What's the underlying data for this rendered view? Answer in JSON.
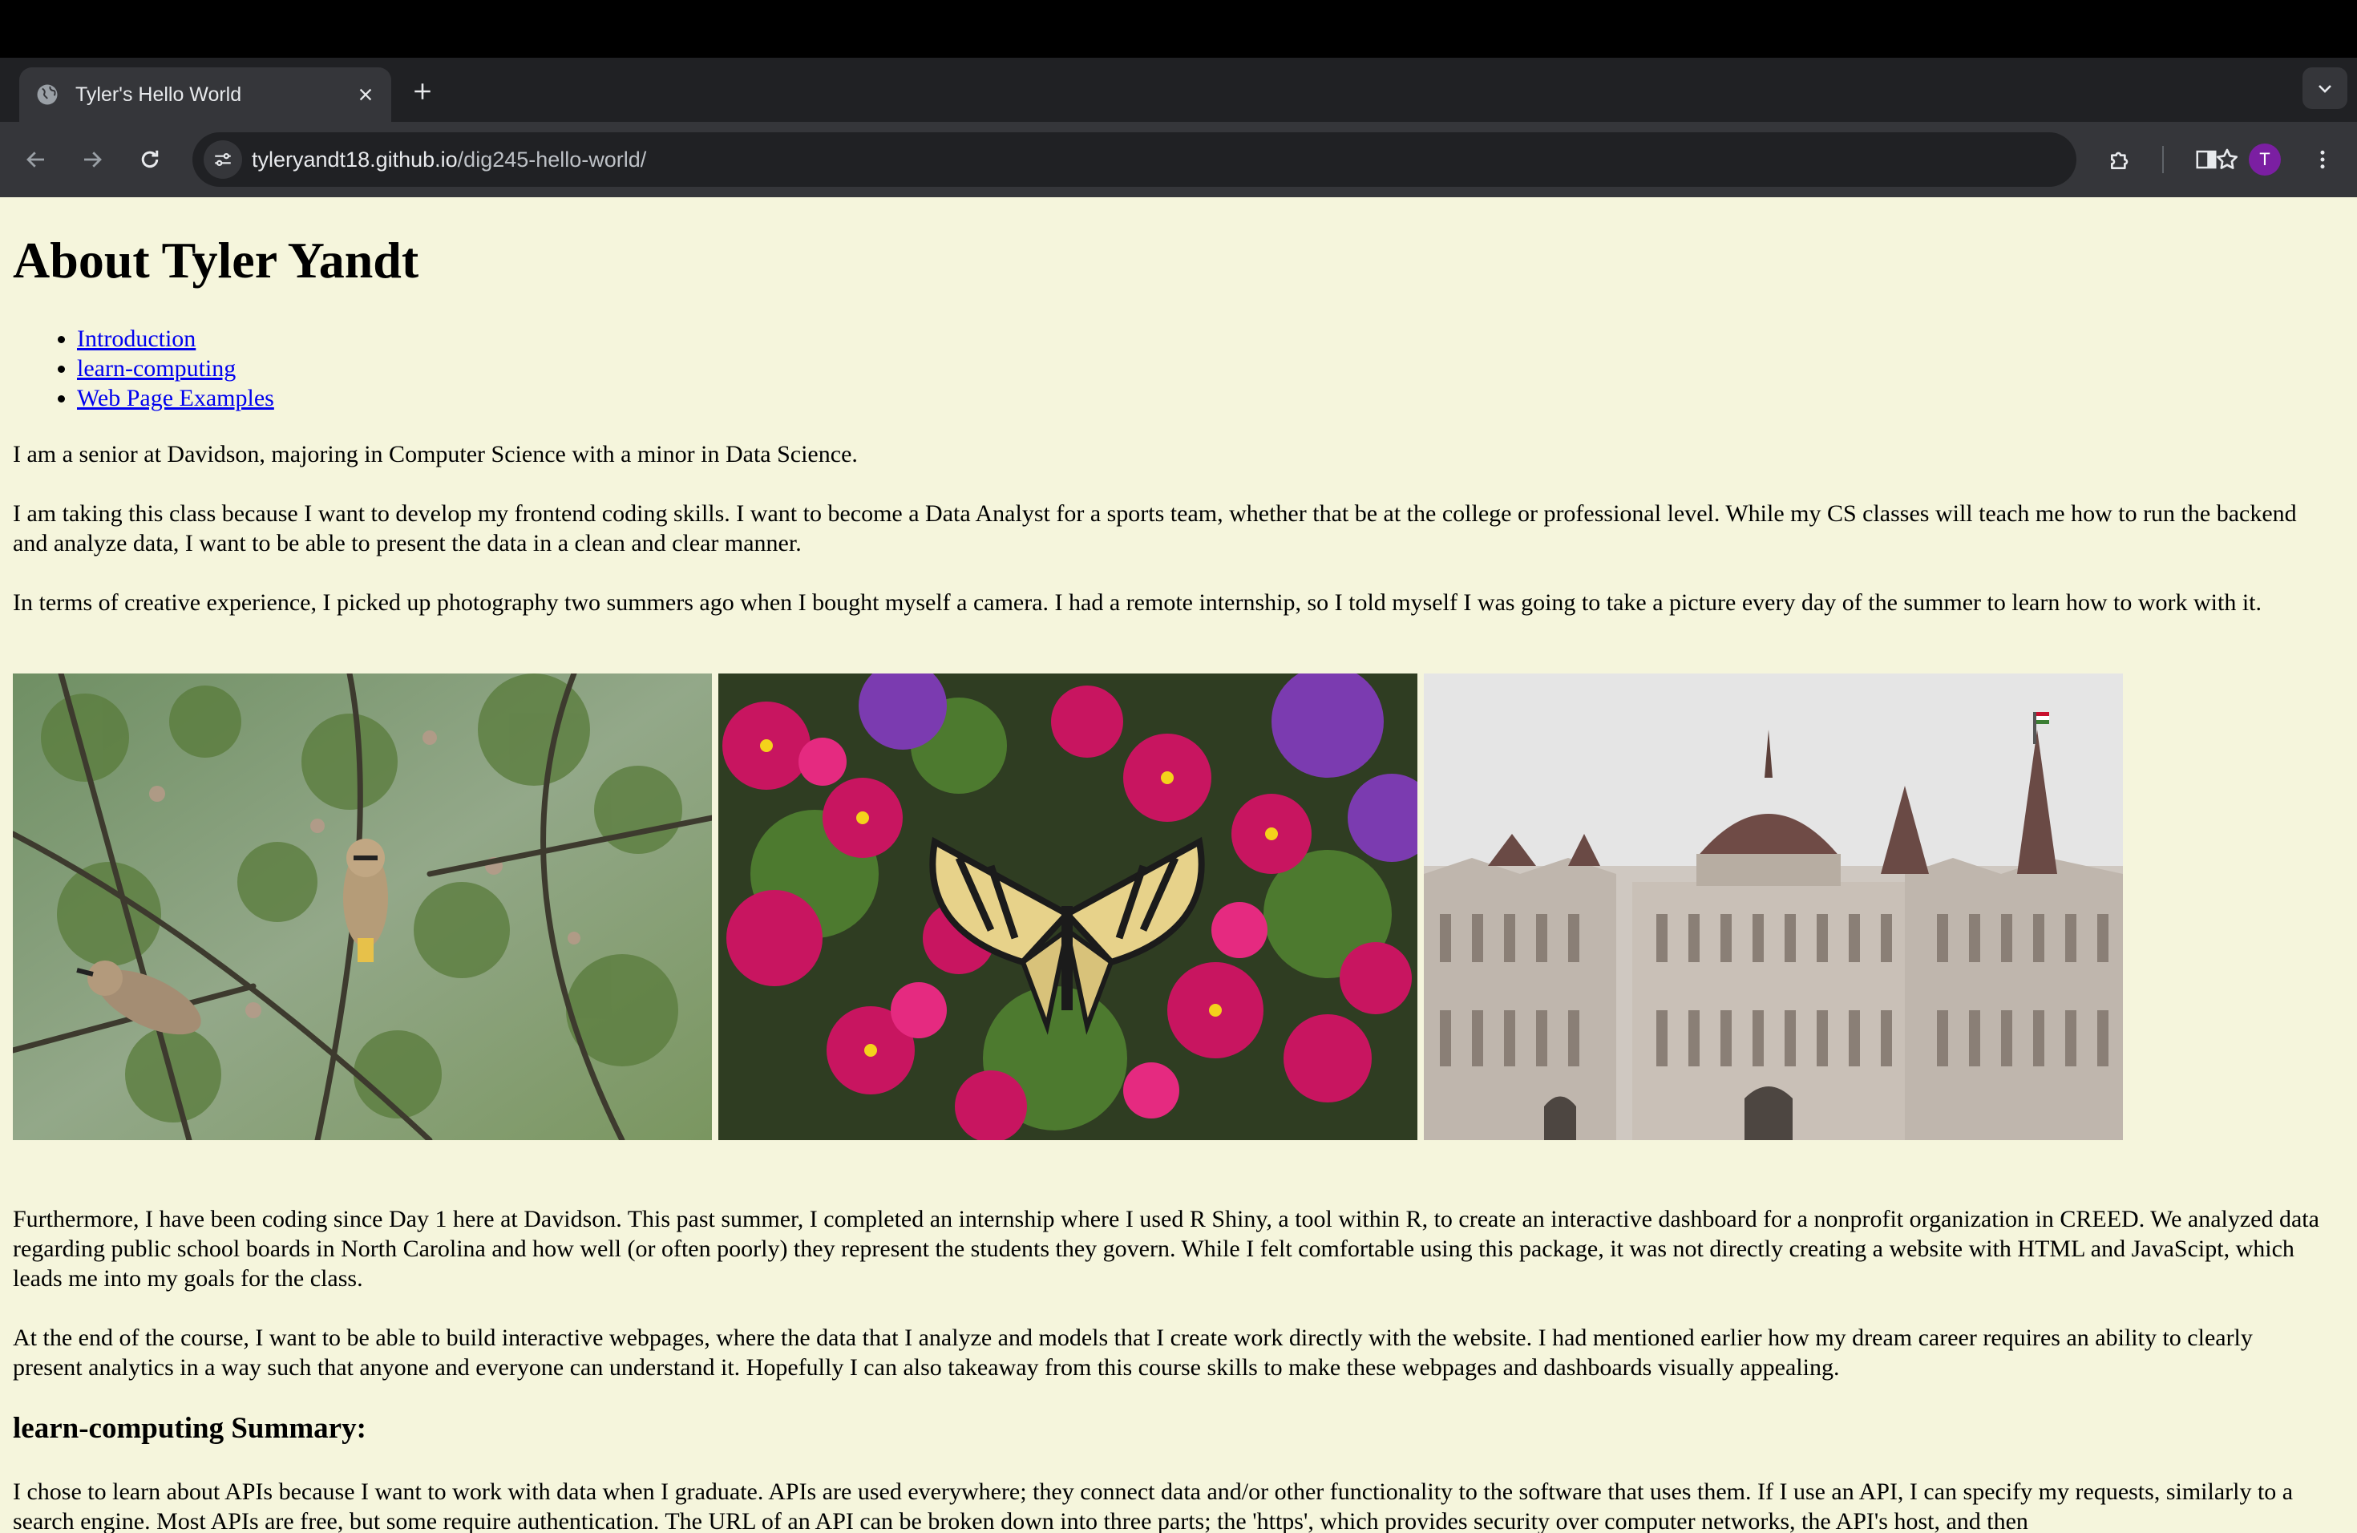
{
  "browser": {
    "tab_title": "Tyler's Hello World",
    "url_host": "tyleryandt18.github.io",
    "url_path": "/dig245-hello-world/",
    "profile_initial": "T",
    "profile_color": "#7b1fa2"
  },
  "page": {
    "heading": "About Tyler Yandt",
    "nav_links": [
      "Introduction",
      "learn-computing",
      "Web Page Examples"
    ],
    "intro_paragraphs": [
      "I am a senior at Davidson, majoring in Computer Science with a minor in Data Science.",
      "I am taking this class because I want to develop my frontend coding skills. I want to become a Data Analyst for a sports team, whether that be at the college or professional level. While my CS classes will teach me how to run the backend and analyze data, I want to be able to present the data in a clean and clear manner.",
      "In terms of creative experience, I picked up photography two summers ago when I bought myself a camera. I had a remote internship, so I told myself I was going to take a picture every day of the summer to learn how to work with it."
    ],
    "photos": [
      "cedar-waxwings-photo",
      "swallowtail-butterfly-photo",
      "parliament-building-photo"
    ],
    "after_paragraphs": [
      "Furthermore, I have been coding since Day 1 here at Davidson. This past summer, I completed an internship where I used R Shiny, a tool within R, to create an interactive dashboard for a nonprofit organization in CREED. We analyzed data regarding public school boards in North Carolina and how well (or often poorly) they represent the students they govern. While I felt comfortable using this package, it was not directly creating a website with HTML and JavaScipt, which leads me into my goals for the class.",
      "At the end of the course, I want to be able to build interactive webpages, where the data that I analyze and models that I create work directly with the website. I had mentioned earlier how my dream career requires an ability to clearly present analytics in a way such that anyone and everyone can understand it. Hopefully I can also takeaway from this course skills to make these webpages and dashboards visually appealing."
    ],
    "summary_heading": "learn-computing Summary:",
    "summary_paragraph": "I chose to learn about APIs because I want to work with data when I graduate. APIs are used everywhere; they connect data and/or other functionality to the software that uses them. If I use an API, I can specify my requests, similarly to a search engine. Most APIs are free, but some require authentication. The URL of an API can be broken down into three parts; the 'https', which provides security over computer networks, the API's host, and then"
  }
}
